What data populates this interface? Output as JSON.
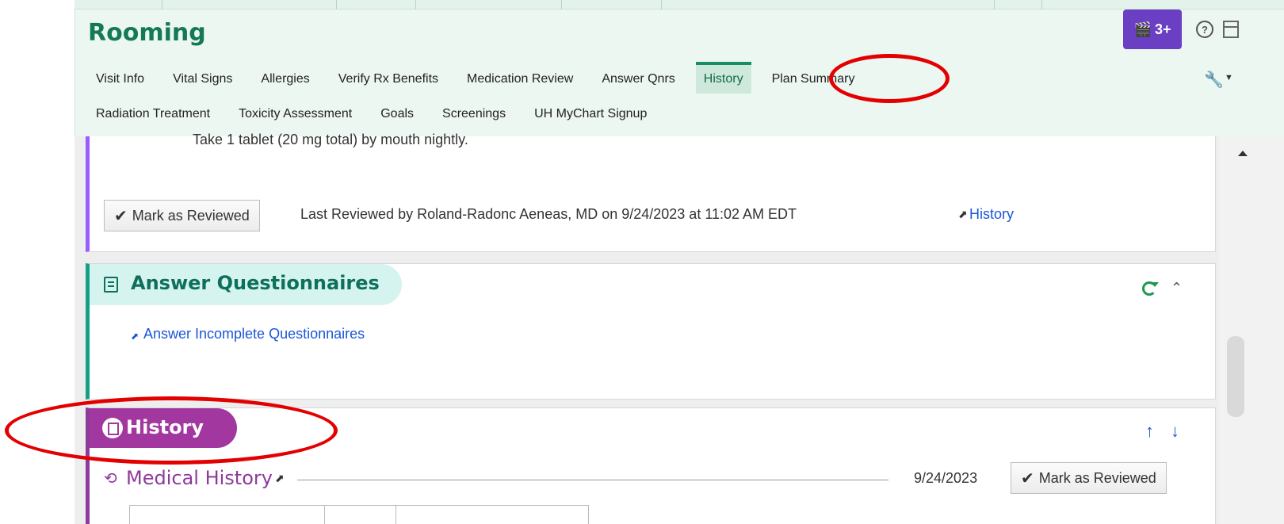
{
  "header": {
    "title": "Rooming",
    "badge_label": "3+",
    "tabs_row1": [
      {
        "label": "Visit Info",
        "active": false
      },
      {
        "label": "Vital Signs",
        "active": false
      },
      {
        "label": "Allergies",
        "active": false
      },
      {
        "label": "Verify Rx Benefits",
        "active": false
      },
      {
        "label": "Medication Review",
        "active": false
      },
      {
        "label": "Answer Qnrs",
        "active": false
      },
      {
        "label": "History",
        "active": true
      },
      {
        "label": "Plan Summary",
        "active": false
      }
    ],
    "tabs_row2": [
      {
        "label": "Radiation Treatment",
        "active": false
      },
      {
        "label": "Toxicity Assessment",
        "active": false
      },
      {
        "label": "Goals",
        "active": false
      },
      {
        "label": "Screenings",
        "active": false
      },
      {
        "label": "UH MyChart Signup",
        "active": false
      }
    ]
  },
  "medication_section": {
    "cut_text": "Take 1 tablet (20 mg total) by mouth nightly.",
    "mark_reviewed_label": "Mark as Reviewed",
    "last_reviewed_text": "Last Reviewed by Roland-Radonc Aeneas, MD on 9/24/2023 at 11:02 AM EDT",
    "history_link": "History"
  },
  "questionnaires_section": {
    "title": "Answer Questionnaires",
    "link": "Answer Incomplete Questionnaires"
  },
  "history_section": {
    "title": "History",
    "subsection_title": "Medical History",
    "reviewed_date": "9/24/2023",
    "mark_reviewed_label": "Mark as Reviewed"
  },
  "colors": {
    "header_bg": "#edf7f2",
    "title_green": "#137a55",
    "badge_purple": "#6a3fc4",
    "questionnaire_teal": "#159f86",
    "history_magenta": "#a2379f",
    "link_blue": "#1a56d8",
    "annotation_red": "#e30000"
  }
}
